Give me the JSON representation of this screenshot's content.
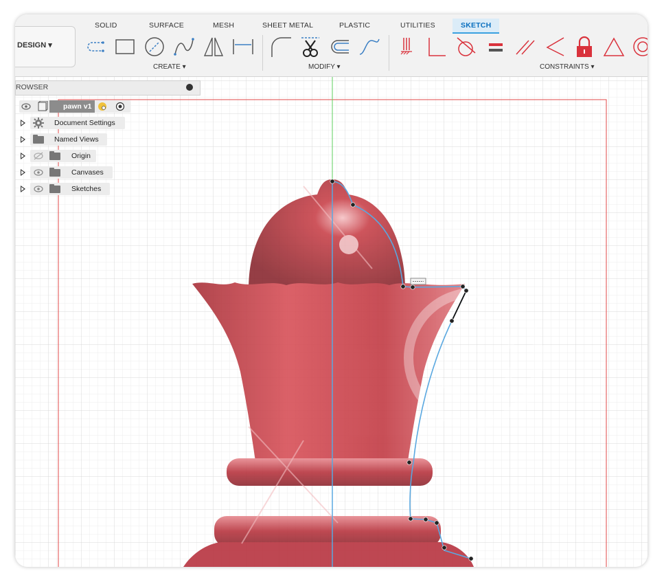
{
  "toolbar": {
    "tabs": [
      "SOLID",
      "SURFACE",
      "MESH",
      "SHEET METAL",
      "PLASTIC",
      "UTILITIES",
      "SKETCH"
    ],
    "active_tab": "SKETCH",
    "workspace_label": "DESIGN ▾",
    "groups": {
      "create": "CREATE ▾",
      "modify": "MODIFY ▾",
      "constraints": "CONSTRAINTS ▾"
    },
    "create_tools": [
      "slot-icon",
      "rectangle-icon",
      "circle-icon",
      "spline-icon",
      "mirror-icon",
      "dimension-icon"
    ],
    "modify_tools": [
      "fillet-icon",
      "trim-icon",
      "offset-icon",
      "curve-icon"
    ],
    "constraint_tools": [
      "fix-icon",
      "perpendicular-icon",
      "tangent-icon",
      "equal-icon",
      "parallel-icon",
      "angle-icon",
      "lock-icon",
      "triangle-icon",
      "concentric-icon"
    ]
  },
  "browser": {
    "title": "ROWSER",
    "component": "pawn v1",
    "items": [
      {
        "label": "Document Settings",
        "icon": "gear-icon"
      },
      {
        "label": "Named Views",
        "icon": "folder-icon"
      },
      {
        "label": "Origin",
        "icon": "folder-icon",
        "visibility": "hidden"
      },
      {
        "label": "Canvases",
        "icon": "folder-icon",
        "visibility": "visible"
      },
      {
        "label": "Sketches",
        "icon": "folder-icon",
        "visibility": "visible"
      }
    ]
  },
  "colors": {
    "accent": "#39a0e0",
    "sketch_line": "#5aa8e0",
    "sketch_limit": "#e04a4a",
    "canvas_red": "#cc3b46",
    "lock_red": "#d9323c"
  }
}
